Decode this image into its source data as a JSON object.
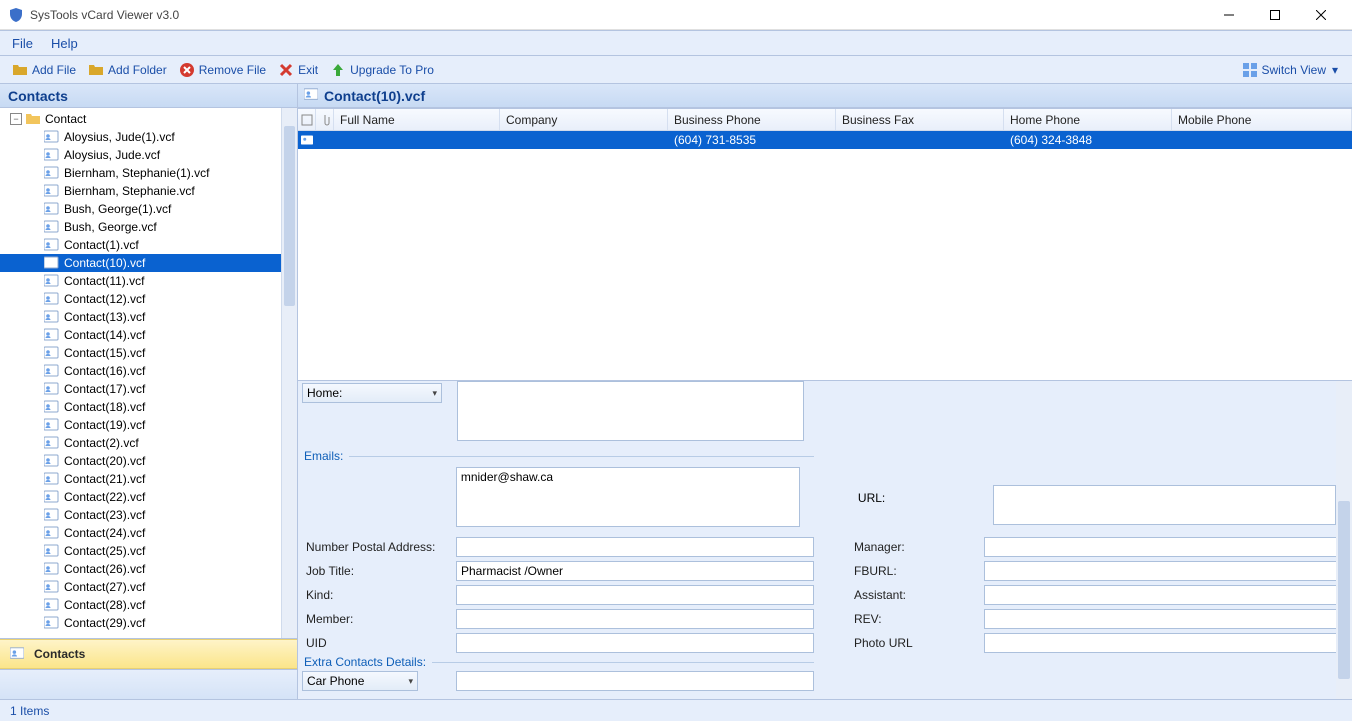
{
  "window": {
    "title": "SysTools vCard Viewer v3.0"
  },
  "menu": {
    "file": "File",
    "help": "Help"
  },
  "toolbar": {
    "add_file": "Add File",
    "add_folder": "Add Folder",
    "remove_file": "Remove File",
    "exit": "Exit",
    "upgrade": "Upgrade To Pro",
    "switch_view": "Switch View"
  },
  "left": {
    "header": "Contacts",
    "root": "Contact",
    "items": [
      "Aloysius, Jude(1).vcf",
      "Aloysius, Jude.vcf",
      "Biernham, Stephanie(1).vcf",
      "Biernham, Stephanie.vcf",
      "Bush, George(1).vcf",
      "Bush, George.vcf",
      "Contact(1).vcf",
      "Contact(10).vcf",
      "Contact(11).vcf",
      "Contact(12).vcf",
      "Contact(13).vcf",
      "Contact(14).vcf",
      "Contact(15).vcf",
      "Contact(16).vcf",
      "Contact(17).vcf",
      "Contact(18).vcf",
      "Contact(19).vcf",
      "Contact(2).vcf",
      "Contact(20).vcf",
      "Contact(21).vcf",
      "Contact(22).vcf",
      "Contact(23).vcf",
      "Contact(24).vcf",
      "Contact(25).vcf",
      "Contact(26).vcf",
      "Contact(27).vcf",
      "Contact(28).vcf",
      "Contact(29).vcf"
    ],
    "selected_index": 7,
    "contacts_button": "Contacts"
  },
  "right": {
    "header": "Contact(10).vcf",
    "columns": [
      "Full Name",
      "Company",
      "Business Phone",
      "Business Fax",
      "Home Phone",
      "Mobile Phone"
    ],
    "row": {
      "full_name": "",
      "company": "",
      "business_phone": "(604) 731-8535",
      "business_fax": "",
      "home_phone": "(604) 324-3848",
      "mobile_phone": ""
    }
  },
  "detail": {
    "home_combo": "Home:",
    "emails_label": "Emails:",
    "email_value": "mnider@shaw.ca",
    "url_label": "URL:",
    "fields_left": {
      "number_postal": {
        "label": "Number Postal Address:",
        "value": ""
      },
      "job_title": {
        "label": "Job Title:",
        "value": "Pharmacist /Owner"
      },
      "kind": {
        "label": "Kind:",
        "value": ""
      },
      "member": {
        "label": "Member:",
        "value": ""
      },
      "uid": {
        "label": "UID",
        "value": ""
      }
    },
    "fields_right": {
      "manager": {
        "label": "Manager:",
        "value": ""
      },
      "fburl": {
        "label": "FBURL:",
        "value": ""
      },
      "assistant": {
        "label": "Assistant:",
        "value": ""
      },
      "rev": {
        "label": "REV:",
        "value": ""
      },
      "photo_url": {
        "label": "Photo URL",
        "value": ""
      }
    },
    "extra_label": "Extra Contacts Details:",
    "extra_combo": "Car Phone"
  },
  "status": {
    "items": "1 Items"
  }
}
